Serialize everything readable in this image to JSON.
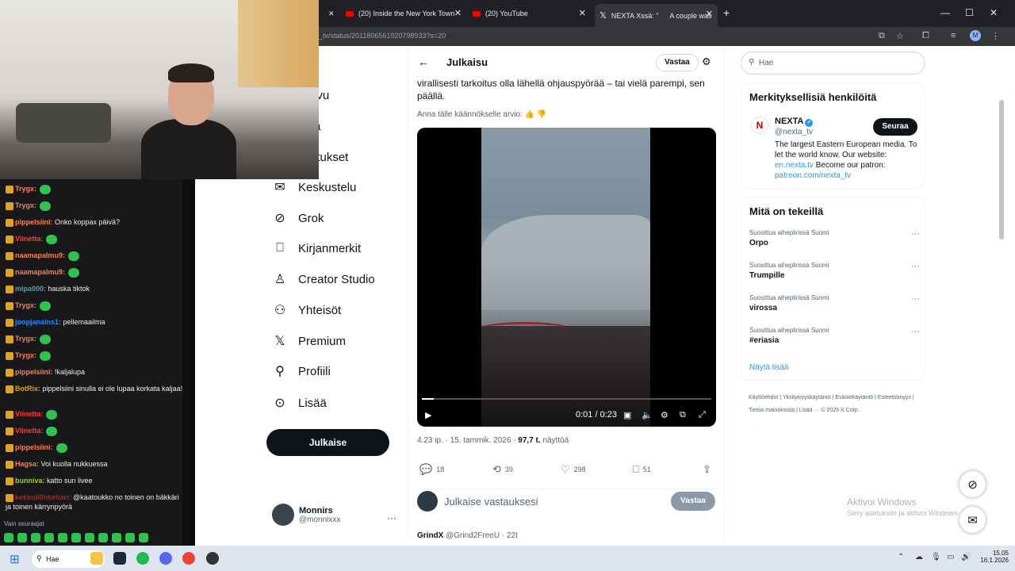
{
  "browser": {
    "tabs": [
      {
        "title": "(20) Inside the New York Town"
      },
      {
        "title": "(20) YouTube"
      },
      {
        "title": "NEXTA Xssä: \"",
        "title_tail": "A couple was"
      }
    ],
    "url": "_tv/status/2011806561920798933?s=20",
    "profile_initial": "M"
  },
  "nav": {
    "partial": [
      "ivu",
      "a",
      "itukset"
    ],
    "items": [
      {
        "label": "Keskustelu"
      },
      {
        "label": "Grok"
      },
      {
        "label": "Kirjanmerkit"
      },
      {
        "label": "Creator Studio"
      },
      {
        "label": "Yhteisöt"
      },
      {
        "label": "Premium"
      },
      {
        "label": "Profiili"
      },
      {
        "label": "Lisää"
      }
    ],
    "post_label": "Julkaise",
    "account": {
      "name": "Monnirs",
      "handle": "@monnixxx"
    }
  },
  "post": {
    "header": "Julkaisu",
    "reply_label": "Vastaa",
    "text": "virallisesti tarkoitus olla lähellä ohjauspyörää – tai vielä parempi, sen päällä.",
    "rate_prompt": "Anna tälle käännökselle arvio:",
    "video": {
      "time": "0:01 / 0:23",
      "progress": 0.04
    },
    "meta_time": "4.23 ip. · 15. tammik. 2026 ·",
    "views": "97,7 t.",
    "views_label": "näyttöä",
    "counts": {
      "replies": "18",
      "reposts": "39",
      "likes": "298",
      "bookmarks": "51"
    },
    "reply_placeholder": "Julkaise vastauksesi",
    "reply_button": "Vastaa",
    "next_reply": "GrindX",
    "next_handle": "@Grind2FreeU · 22t"
  },
  "sidebar": {
    "search_placeholder": "Hae",
    "relevant_title": "Merkityksellisiä henkilöitä",
    "nexta": {
      "name": "NEXTA",
      "handle": "@nexta_tv",
      "follow": "Seuraa",
      "bio1": "The largest Eastern European media. To let the world know. Our website:",
      "link1": "en.nexta.tv",
      "bio2": " Become our patron:",
      "link2": "patreon.com/nexta_tv"
    },
    "trends_title": "Mitä on tekeillä",
    "trends": [
      {
        "context": "Suosittua aiheplirissä Suomi",
        "topic": "Orpo"
      },
      {
        "context": "Suosittua aiheplirissä Suomi",
        "topic": "Trumpille"
      },
      {
        "context": "Suosittua aiheplirissä Suomi",
        "topic": "virossa"
      },
      {
        "context": "Suosittua aiheplirissä Suomi",
        "topic": "#eriasia"
      }
    ],
    "show_more": "Näytä lisää",
    "footer": "Käyttöehdot | Yksityisyyskäytäntö | Evästekäytäntö | Esteettömyys | Tietoa mainoksista | Lisää ··· © 2026 X Corp."
  },
  "windows": {
    "activate1": "Aktivoi Windows",
    "activate2": "Siirry asetuksiin ja aktivoi Windows"
  },
  "chat": {
    "messages": [
      {
        "user": "Trygx:",
        "text": "",
        "color": "#ff7f50"
      },
      {
        "user": "Trygx:",
        "text": "",
        "color": "#ff7f50"
      },
      {
        "user": "pippelsiini:",
        "text": " Onko koppax päivä?",
        "color": "#ff7f50"
      },
      {
        "user": "Viinetta:",
        "text": "",
        "color": "#ff3b3b"
      },
      {
        "user": "naamapalmu9:",
        "text": "",
        "color": "#ff7f50"
      },
      {
        "user": "naamapalmu9:",
        "text": "",
        "color": "#ff7f50"
      },
      {
        "user": "mipa000:",
        "text": " hauska tiktok",
        "color": "#5f9ea0"
      },
      {
        "user": "Trygx:",
        "text": "",
        "color": "#ff7f50"
      },
      {
        "user": "joopjanains1:",
        "text": " pellemaailma",
        "color": "#1e90ff"
      },
      {
        "user": "Trygx:",
        "text": "",
        "color": "#ff7f50"
      },
      {
        "user": "Trygx:",
        "text": "",
        "color": "#ff7f50"
      },
      {
        "user": "pippelsiini:",
        "text": " !kaljalupa",
        "color": "#ff7f50"
      },
      {
        "user": "BotRix:",
        "text": " pippelsiini sinulla ei ole lupaa korkata kaljaa!",
        "color": "#daa520"
      },
      {
        "user": "Viinetta:",
        "text": "",
        "color": "#ff3b3b"
      },
      {
        "user": "Viinetta:",
        "text": "",
        "color": "#ff3b3b"
      },
      {
        "user": "pippelsiini:",
        "text": "",
        "color": "#ff7f50"
      },
      {
        "user": "Hagsa:",
        "text": " Voi kuolla nukkuessa",
        "color": "#ff7f50"
      },
      {
        "user": "bunniva:",
        "text": " katto sun livee",
        "color": "#9acd32"
      },
      {
        "user": "kekkuli0nkehari:",
        "text": " @kaatoukko no toinen on bäkkäri ja toinen kärrynpyörä",
        "color": "#b22222"
      }
    ],
    "follow_only": "Vain seuraajat"
  },
  "taskbar": {
    "search": "Hae",
    "time": "15.05",
    "date": "16.1.2026"
  },
  "colors": {
    "accent": "#1d9bf0",
    "dark": "#0f1419",
    "chat_bg": "#18181b"
  }
}
